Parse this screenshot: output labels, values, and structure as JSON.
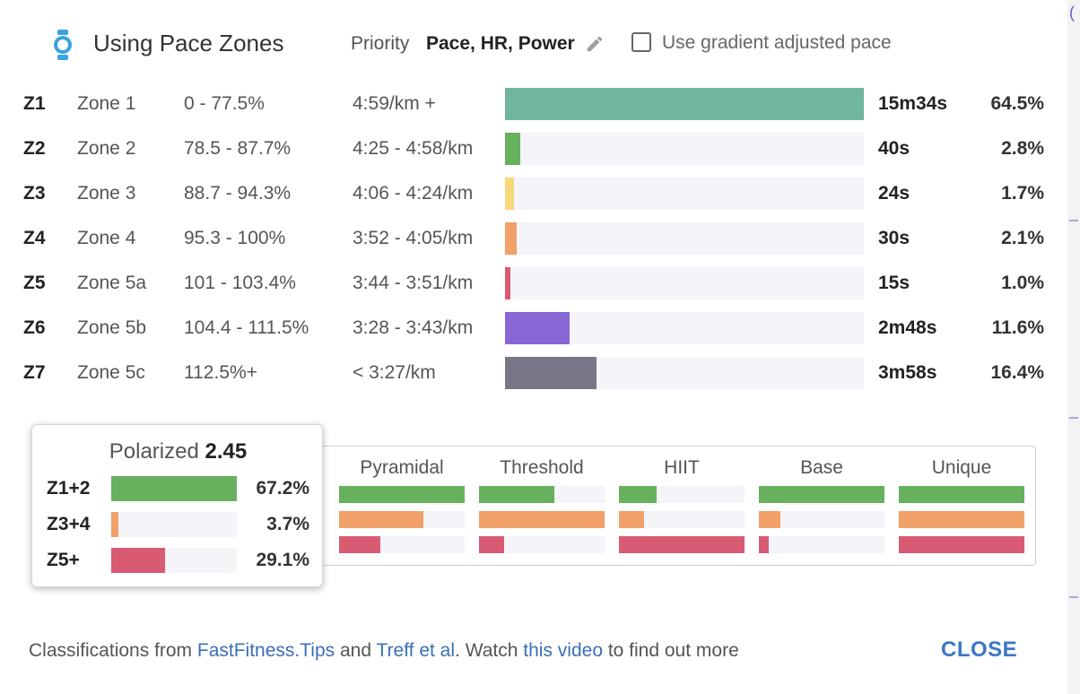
{
  "header": {
    "title": "Using Pace Zones",
    "priority_label": "Priority",
    "priority_value": "Pace, HR, Power",
    "gradient_checkbox_label": "Use gradient adjusted pace",
    "gradient_checked": false
  },
  "zones": [
    {
      "id": "Z1",
      "name": "Zone 1",
      "range": "0 - 77.5%",
      "pace": "4:59/km +",
      "time": "15m34s",
      "percent": "64.5%",
      "fraction": 1.0,
      "color": "#6fb59f"
    },
    {
      "id": "Z2",
      "name": "Zone 2",
      "range": "78.5 - 87.7%",
      "pace": "4:25 - 4:58/km",
      "time": "40s",
      "percent": "2.8%",
      "fraction": 0.043,
      "color": "#66b05e"
    },
    {
      "id": "Z3",
      "name": "Zone 3",
      "range": "88.7 - 94.3%",
      "pace": "4:06 - 4:24/km",
      "time": "24s",
      "percent": "1.7%",
      "fraction": 0.026,
      "color": "#f5d97a"
    },
    {
      "id": "Z4",
      "name": "Zone 4",
      "range": "95.3 - 100%",
      "pace": "3:52 - 4:05/km",
      "time": "30s",
      "percent": "2.1%",
      "fraction": 0.033,
      "color": "#f0a068"
    },
    {
      "id": "Z5",
      "name": "Zone 5a",
      "range": "101 - 103.4%",
      "pace": "3:44 - 3:51/km",
      "time": "15s",
      "percent": "1.0%",
      "fraction": 0.016,
      "color": "#d95b73"
    },
    {
      "id": "Z6",
      "name": "Zone 5b",
      "range": "104.4 - 111.5%",
      "pace": "3:28 - 3:43/km",
      "time": "2m48s",
      "percent": "11.6%",
      "fraction": 0.18,
      "color": "#8866d6"
    },
    {
      "id": "Z7",
      "name": "Zone 5c",
      "range": "112.5%+",
      "pace": "< 3:27/km",
      "time": "3m58s",
      "percent": "16.4%",
      "fraction": 0.255,
      "color": "#7a7587"
    }
  ],
  "polarized": {
    "title_prefix": "Polarized",
    "title_value": "2.45",
    "rows": [
      {
        "label": "Z1+2",
        "value": "67.2%",
        "fraction": 1.0,
        "color": "#66b05e"
      },
      {
        "label": "Z3+4",
        "value": "3.7%",
        "fraction": 0.055,
        "color": "#f0a068"
      },
      {
        "label": "Z5+",
        "value": "29.1%",
        "fraction": 0.43,
        "color": "#d95b73"
      }
    ]
  },
  "classifications": [
    {
      "name": "Pyramidal",
      "fractions": [
        1.0,
        0.67,
        0.33
      ]
    },
    {
      "name": "Threshold",
      "fractions": [
        0.6,
        1.0,
        0.2
      ]
    },
    {
      "name": "HIIT",
      "fractions": [
        0.3,
        0.2,
        1.0
      ]
    },
    {
      "name": "Base",
      "fractions": [
        1.0,
        0.17,
        0.08
      ]
    },
    {
      "name": "Unique",
      "fractions": [
        1.0,
        1.0,
        1.0
      ]
    }
  ],
  "classification_colors": [
    "#66b05e",
    "#f0a068",
    "#d95b73"
  ],
  "footer": {
    "prefix": "Classifications from ",
    "link1": "FastFitness.Tips",
    "mid1": " and ",
    "link2": "Treff et al",
    "mid2": ". Watch ",
    "link3": "this video",
    "suffix": " to find out more",
    "close_label": "CLOSE"
  }
}
